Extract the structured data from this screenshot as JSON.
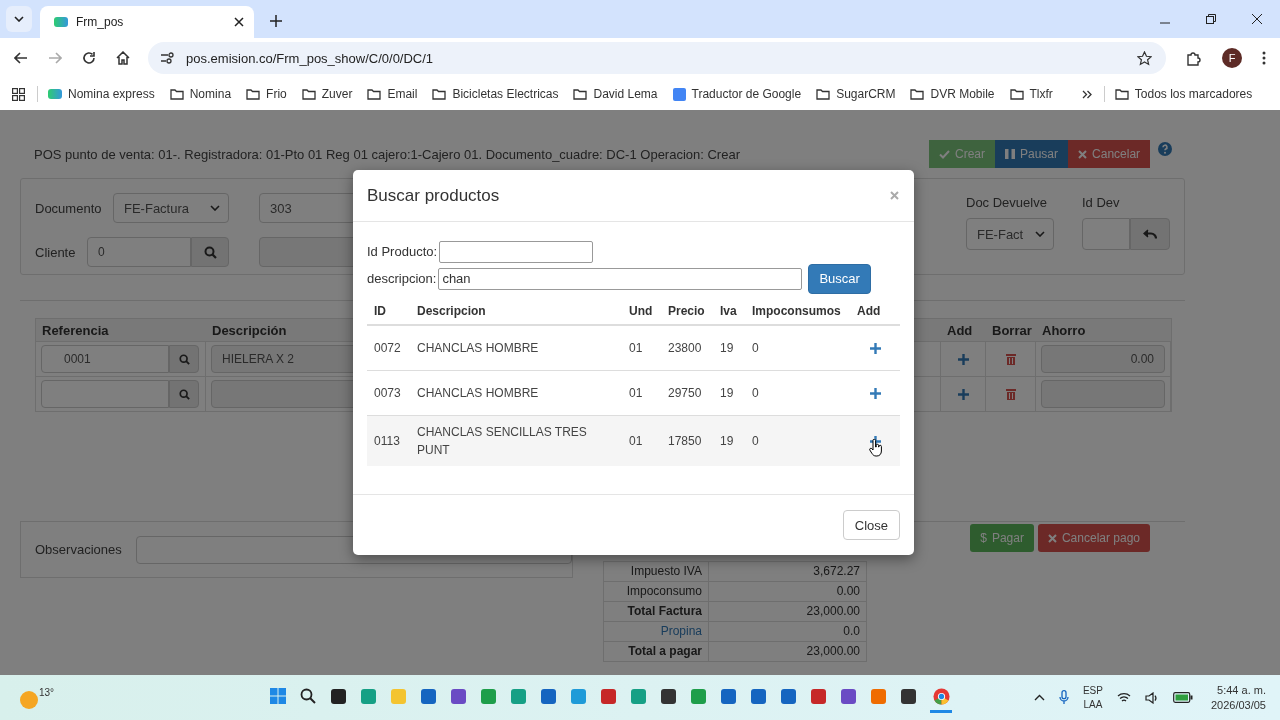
{
  "browser": {
    "tabs": [
      {
        "title": "Frm_pos",
        "selected": true
      }
    ],
    "url": "pos.emision.co/Frm_pos_show/C/0/0/DC/1",
    "avatar": "F",
    "bookmarks": [
      {
        "label": "Nomina express",
        "kind": "site"
      },
      {
        "label": "Nomina",
        "kind": "folder"
      },
      {
        "label": "Frio",
        "kind": "folder"
      },
      {
        "label": "Zuver",
        "kind": "folder"
      },
      {
        "label": "Email",
        "kind": "folder"
      },
      {
        "label": "Bicicletas Electricas",
        "kind": "folder"
      },
      {
        "label": "David Lema",
        "kind": "folder"
      },
      {
        "label": "Traductor de Google",
        "kind": "translate"
      },
      {
        "label": "SugarCRM",
        "kind": "folder"
      },
      {
        "label": "DVR Mobile",
        "kind": "folder"
      },
      {
        "label": "Tlxfr",
        "kind": "folder"
      }
    ],
    "all_bookmarks": "Todos los marcadores"
  },
  "page": {
    "header": "POS punto de venta: 01-. Registradora: 01-Pto 01 Reg 01 cajero:1-Cajero 01. Documento_cuadre: DC-1 Operacion: Crear",
    "actions": [
      {
        "label": "Crear",
        "kind": "success",
        "disabled": true
      },
      {
        "label": "Pausar",
        "kind": "primary",
        "disabled": false
      },
      {
        "label": "Cancelar",
        "kind": "danger",
        "disabled": false
      }
    ],
    "form": {
      "documento_label": "Documento",
      "documento": "FE-Factura",
      "numero": "303",
      "cliente_label": "Cliente",
      "cliente": "0",
      "doc_devuelve_label": "Doc Devuelve",
      "doc_devuelve": "FE-Fact",
      "id_dev_label": "Id Dev"
    },
    "lines": {
      "columns": [
        "Referencia",
        "Descripción",
        "Add",
        "Borrar",
        "Ahorro"
      ],
      "rows": [
        {
          "referencia": "0001",
          "descripcion": "HIELERA X 2",
          "ahorro": "0.00"
        },
        {}
      ]
    },
    "observaciones_label": "Observaciones",
    "pay_buttons": [
      {
        "label": "Pagar",
        "kind": "success",
        "icon": "$"
      },
      {
        "label": "Cancelar pago",
        "kind": "danger"
      }
    ],
    "totals": [
      {
        "label": "Impuesto IVA",
        "value": "3,672.27",
        "kind": "plain"
      },
      {
        "label": "Impoconsumo",
        "value": "0.00",
        "kind": "plain"
      },
      {
        "label": "Total Factura",
        "value": "23,000.00",
        "kind": "bold"
      },
      {
        "label": "Propina",
        "value": "0.0",
        "kind": "link"
      },
      {
        "label": "Total a pagar",
        "value": "23,000.00",
        "kind": "bold"
      }
    ]
  },
  "modal": {
    "title": "Buscar productos",
    "id_label": "Id Producto:",
    "desc_label": "descripcion:",
    "desc_value": "chan",
    "search_button": "Buscar",
    "columns": [
      "ID",
      "Descripcion",
      "Und",
      "Precio",
      "Iva",
      "Impoconsumos",
      "Add"
    ],
    "rows": [
      {
        "id": "0072",
        "descripcion": "CHANCLAS HOMBRE",
        "und": "01",
        "precio": "23800",
        "iva": "19",
        "impoconsumos": "0",
        "hovered": false
      },
      {
        "id": "0073",
        "descripcion": "CHANCLAS HOMBRE",
        "und": "01",
        "precio": "29750",
        "iva": "19",
        "impoconsumos": "0",
        "hovered": false
      },
      {
        "id": "0113",
        "descripcion": "CHANCLAS SENCILLAS TRES PUNT",
        "und": "01",
        "precio": "17850",
        "iva": "19",
        "impoconsumos": "0",
        "hovered": true
      }
    ],
    "close_button": "Close"
  },
  "taskbar": {
    "weather": "13°",
    "apps": [
      {
        "kind": "start",
        "selected": false
      },
      {
        "kind": "search",
        "selected": false
      },
      {
        "kind": "taskview",
        "selected": false
      },
      {
        "kind": "teal",
        "selected": false
      },
      {
        "kind": "folder",
        "selected": false
      },
      {
        "kind": "blue",
        "selected": false
      },
      {
        "kind": "purple",
        "selected": false
      },
      {
        "kind": "green",
        "selected": false
      },
      {
        "kind": "teal",
        "selected": false
      },
      {
        "kind": "blue",
        "selected": false
      },
      {
        "kind": "edge",
        "selected": false
      },
      {
        "kind": "red",
        "selected": false
      },
      {
        "kind": "teal",
        "selected": false
      },
      {
        "kind": "dark",
        "selected": false
      },
      {
        "kind": "green",
        "selected": false
      },
      {
        "kind": "blue",
        "selected": false
      },
      {
        "kind": "blue",
        "selected": false
      },
      {
        "kind": "blue",
        "selected": false
      },
      {
        "kind": "red",
        "selected": false
      },
      {
        "kind": "purple",
        "selected": false
      },
      {
        "kind": "orange",
        "selected": false
      },
      {
        "kind": "dark",
        "selected": false
      },
      {
        "kind": "chrome",
        "selected": true
      }
    ],
    "lang": "ESP",
    "layout": "LAA",
    "time": "5:44 a. m.",
    "date": "2026/03/05"
  }
}
